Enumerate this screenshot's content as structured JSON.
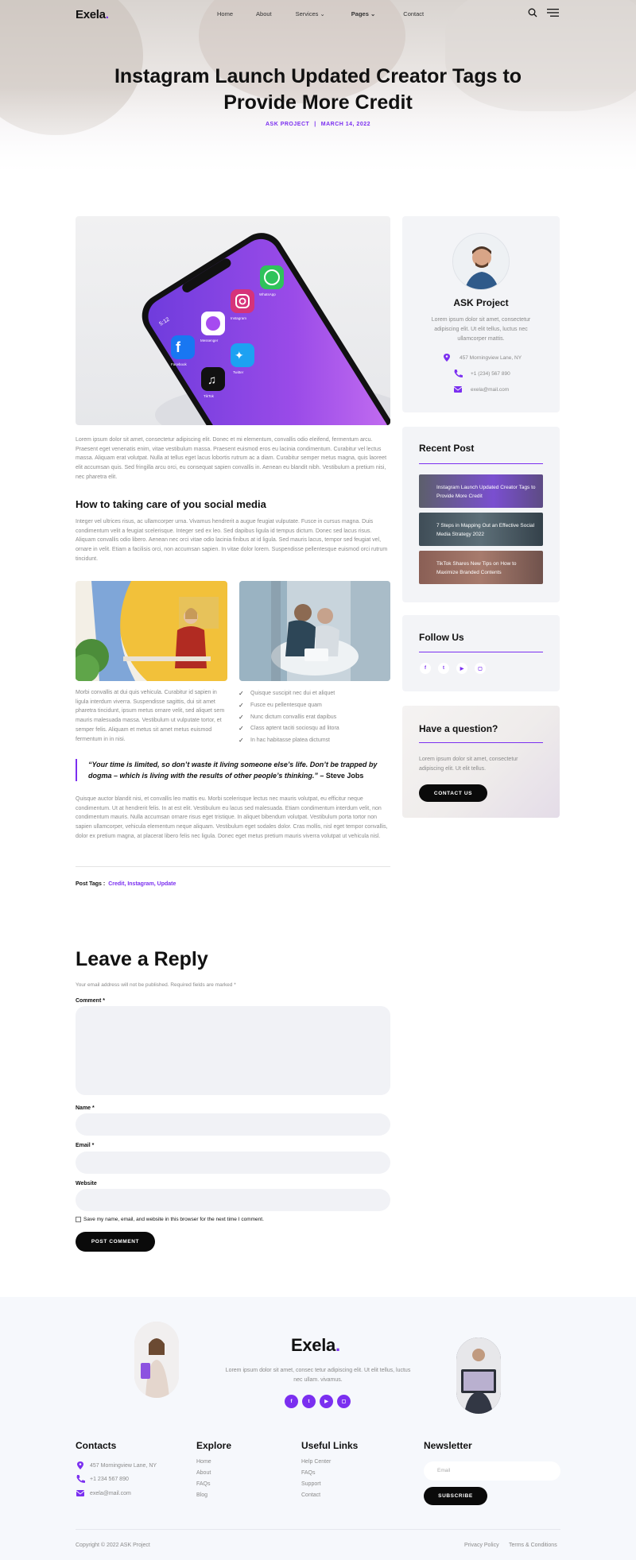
{
  "header": {
    "logo": "Exela",
    "logo_dot": ".",
    "nav": [
      "Home",
      "About",
      "Services",
      "Pages",
      "Contact"
    ]
  },
  "hero": {
    "title_line1": "Instagram Launch Updated Creator Tags to",
    "title_line2": "Provide More Credit",
    "author": "ASK PROJECT",
    "separator": "|",
    "date": "MARCH 14, 2022"
  },
  "article": {
    "phone_time": "5:12",
    "app_labels": [
      "Facebook",
      "Messenger",
      "Instagram",
      "WhatsApp",
      "TikTok",
      "Twitter"
    ],
    "intro": "Lorem ipsum dolor sit amet, consectetur adipiscing elit. Donec et mi elementum, convallis odio eleifend, fermentum arcu. Praesent eget venenatis enim, vitae vestibulum massa. Praesent euismod eros eu lacinia condimentum. Curabitur vel lectus massa. Aliquam erat volutpat. Nulla at tellus eget lacus lobortis rutrum ac a diam. Curabitur semper metus magna, quis laoreet elit accumsan quis. Sed fringilla arcu orci, eu consequat sapien convallis in. Aenean eu blandit nibh. Vestibulum a pretium nisi, nec pharetra elit.",
    "subheading": "How to taking care of you social media",
    "para2": "Integer vel ultrices risus, ac ullamcorper urna. Vivamus hendrerit a augue feugiat vulputate. Fusce in cursus magna. Duis condimentum velit a feugiat scelerisque. Integer sed ex leo. Sed dapibus ligula id tempus dictum. Donec sed lacus risus. Aliquam convallis odio libero. Aenean nec orci vitae odio lacinia finibus at id ligula. Sed mauris lacus, tempor sed feugiat vel, ornare in velit. Etiam a facilisis orci, non accumsan sapien. In vitae dolor lorem. Suspendisse pellentesque euismod orci rutrum tincidunt.",
    "col_text": "Morbi convallis at dui quis vehicula. Curabitur id sapien in ligula interdum viverra. Suspendisse sagittis, dui sit amet pharetra tincidunt, ipsum metus ornare velit, sed aliquet sem mauris malesuada massa. Vestibulum ut vulputate tortor, et semper felis. Aliquam et metus sit amet metus euismod fermentum in in nisi.",
    "checklist": [
      "Quisque suscipit nec dui et aliquet",
      "Fusce eu pellentesque quam",
      "Nunc dictum convallis erat dapibus",
      "Class aptent taciti sociosqu ad litora",
      "In hac habitasse platea dictumst"
    ],
    "quote": "“Your time is limited, so don’t waste it living someone else’s life. Don’t be trapped by dogma – which is living with the results of other people’s thinking.”",
    "quote_author": " – Steve Jobs",
    "para3": "Quisque auctor blandit nisi, et convallis leo mattis eu. Morbi scelerisque lectus nec mauris volutpat, eu efficitur neque condimentum. Ut at hendrerit felis. In at est elit. Vestibulum eu lacus sed malesuada. Etiam condimentum interdum velit, non condimentum mauris. Nulla accumsan ornare risus eget tristique. In aliquet bibendum volutpat. Vestibulum porta tortor non sapien ullamcorper, vehicula elementum neque aliquam. Vestibulum eget sodales dolor. Cras mollis, nisl eget tempor convallis, dolor ex pretium magna, at placerat libero felis nec ligula. Donec eget metus pretium mauris viverra volutpat ut vehicula nisl.",
    "tags_label": "Post Tags :",
    "tags": "Credit, Instagram, Update"
  },
  "sidebar": {
    "author_name": "ASK Project",
    "author_desc": "Lorem ipsum dolor sit amet, consectetur adipiscing elit. Ut elit tellus, luctus nec ullamcorper mattis.",
    "address": "457 Morningview Lane, NY",
    "phone": "+1 (234) 567 890",
    "email": "exela@mail.com",
    "recent_title": "Recent Post",
    "recent_posts": [
      "Instagram Launch Updated Creator Tags to Provide More Credit",
      "7 Steps in Mapping Out an Effective Social Media Strategy 2022",
      "TikTok Shares New Tips on How to Maximize Branded Contents"
    ],
    "follow_title": "Follow Us",
    "social_icons": [
      "facebook-icon",
      "twitter-icon",
      "youtube-icon",
      "instagram-icon"
    ],
    "question_title": "Have a question?",
    "question_desc": "Lorem ipsum dolor sit amet, consectetur adipiscing elit. Ut elit tellus.",
    "contact_button": "CONTACT US"
  },
  "reply": {
    "title": "Leave a Reply",
    "note": "Your email address will not be published. Required fields are marked *",
    "comment_label": "Comment *",
    "name_label": "Name *",
    "email_label": "Email *",
    "website_label": "Website",
    "save_label": "Save my name, email, and website in this browser for the next time I comment.",
    "submit": "POST COMMENT"
  },
  "footer": {
    "logo": "Exela",
    "logo_dot": ".",
    "desc": "Lorem ipsum dolor sit amet, consec tetur adipiscing elit. Ut elit tellus, luctus nec ullam. vivamus.",
    "contacts_title": "Contacts",
    "address": "457 Morningview Lane, NY",
    "phone": "+1 234 567 890",
    "email": "exela@mail.com",
    "explore_title": "Explore",
    "explore": [
      "Home",
      "About",
      "FAQs",
      "Blog"
    ],
    "useful_title": "Useful Links",
    "useful": [
      "Help Center",
      "FAQs",
      "Support",
      "Contact"
    ],
    "newsletter_title": "Newsletter",
    "newsletter_placeholder": "Email",
    "subscribe": "SUBSCRIBE",
    "copyright": "Copyright © 2022 ASK Project",
    "privacy": "Privacy Policy",
    "terms": "Terms & Conditions"
  },
  "colors": {
    "accent": "#7b2ff0",
    "dark": "#0a0a0a",
    "card_bg": "#f3f4f7"
  }
}
